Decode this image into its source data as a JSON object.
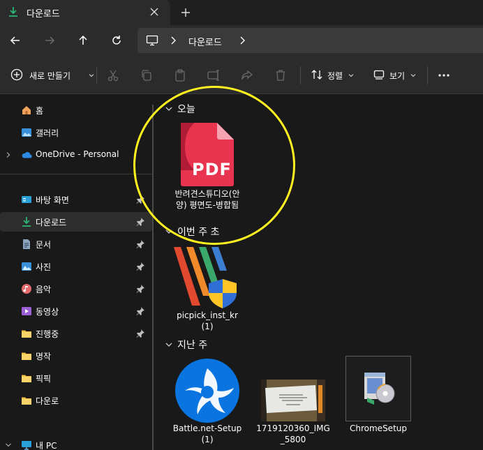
{
  "tab": {
    "title": "다운로드",
    "close": "close",
    "new_tab": "new-tab"
  },
  "address": {
    "crumb": "다운로드"
  },
  "toolbar": {
    "new_label": "새로 만들기",
    "sort_label": "정렬",
    "view_label": "보기"
  },
  "sidebar": {
    "items": [
      {
        "label": "홈",
        "icon": "home-icon"
      },
      {
        "label": "갤러리",
        "icon": "gallery-icon"
      },
      {
        "label": "OneDrive - Personal",
        "icon": "onedrive-icon"
      },
      {
        "label": "바탕 화면",
        "icon": "desktop-icon"
      },
      {
        "label": "다운로드",
        "icon": "download-icon"
      },
      {
        "label": "문서",
        "icon": "documents-icon"
      },
      {
        "label": "사진",
        "icon": "pictures-icon"
      },
      {
        "label": "음악",
        "icon": "music-icon"
      },
      {
        "label": "동영상",
        "icon": "videos-icon"
      },
      {
        "label": "진행중",
        "icon": "folder-icon"
      },
      {
        "label": "명작",
        "icon": "folder-icon"
      },
      {
        "label": "픽픽",
        "icon": "folder-icon"
      },
      {
        "label": "다운로",
        "icon": "folder-icon"
      },
      {
        "label": "내 PC",
        "icon": "pc-icon"
      }
    ]
  },
  "groups": {
    "today": "오늘",
    "this_week": "이번 주 초",
    "last_week": "지난 주"
  },
  "files": {
    "pdf": {
      "name": "반려견스튜디오(안양) 평면도-병합됨",
      "badge": "PDF"
    },
    "picpick": {
      "name": "picpick_inst_kr (1)"
    },
    "battlenet": {
      "name": "Battle.net-Setup (1)"
    },
    "img": {
      "name": "1719120360_IMG_5800"
    },
    "chrome": {
      "name": "ChromeSetup"
    }
  },
  "colors": {
    "accent_green": "#2bb673",
    "pdf_red": "#e8344e",
    "highlight": "#fff21e",
    "battlenet_blue": "#0a74e0"
  }
}
